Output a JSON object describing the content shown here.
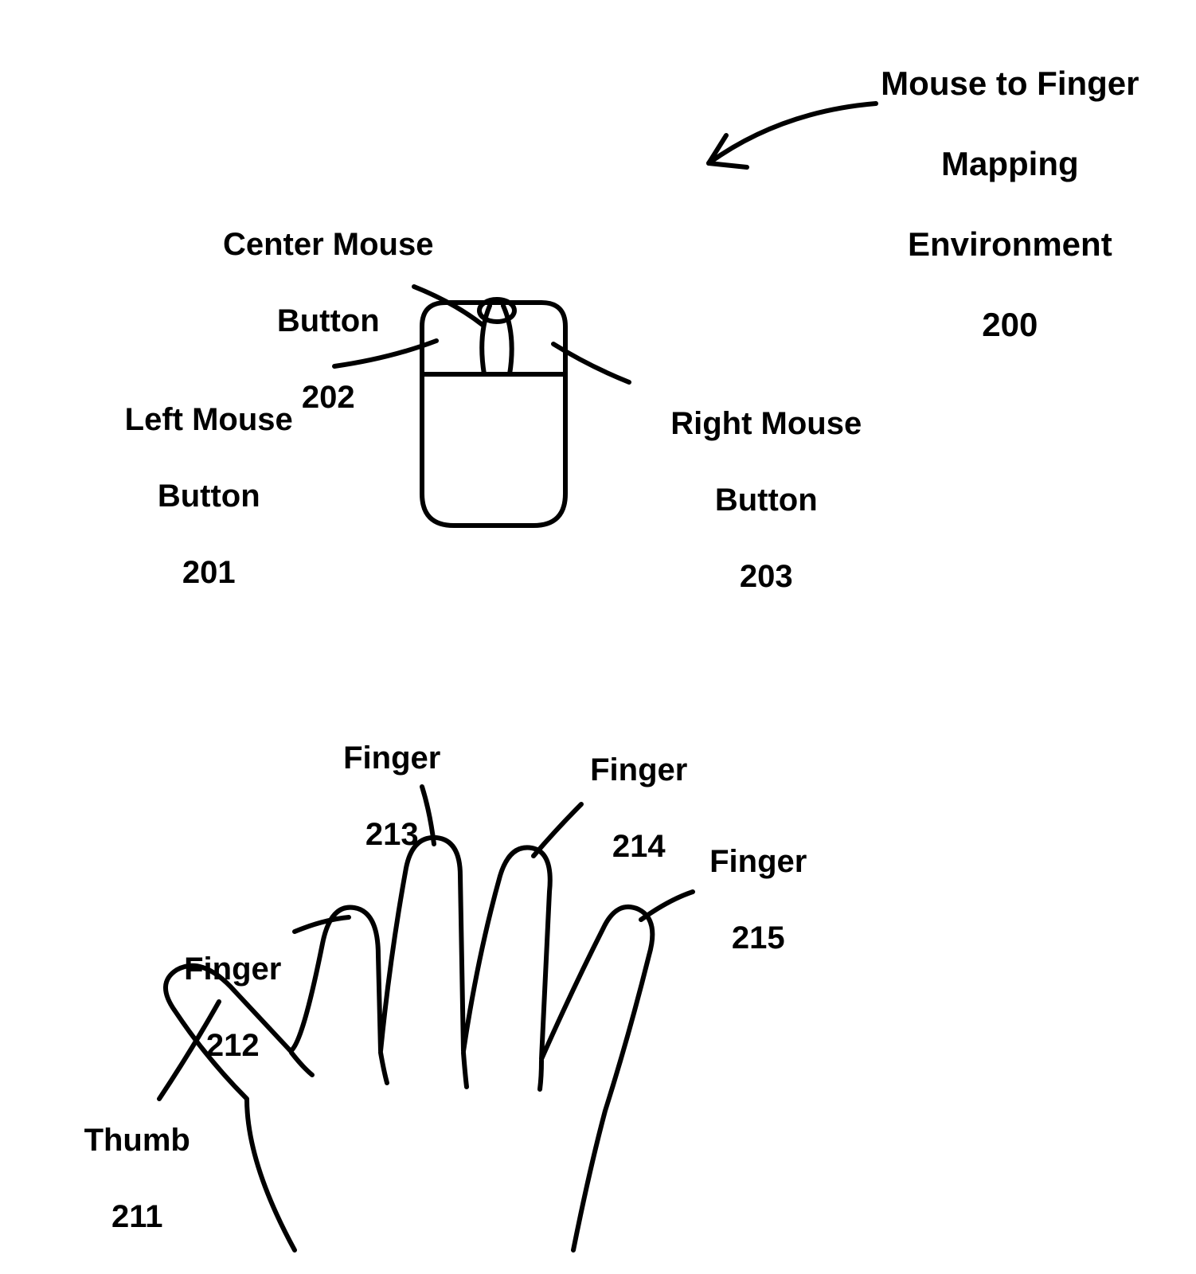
{
  "title": {
    "line1": "Mouse to Finger",
    "line2": "Mapping",
    "line3": "Environment",
    "ref": "200"
  },
  "mouse": {
    "center": {
      "label": "Center Mouse",
      "sub": "Button",
      "ref": "202"
    },
    "left": {
      "label": "Left Mouse",
      "sub": "Button",
      "ref": "201"
    },
    "right": {
      "label": "Right Mouse",
      "sub": "Button",
      "ref": "203"
    }
  },
  "hand": {
    "thumb": {
      "label": "Thumb",
      "ref": "211"
    },
    "index": {
      "label": "Finger",
      "ref": "212"
    },
    "middle": {
      "label": "Finger",
      "ref": "213"
    },
    "ring": {
      "label": "Finger",
      "ref": "214"
    },
    "pinky": {
      "label": "Finger",
      "ref": "215"
    }
  },
  "style": {
    "labelFontSize": "40px",
    "titleFontSize": "42px"
  }
}
